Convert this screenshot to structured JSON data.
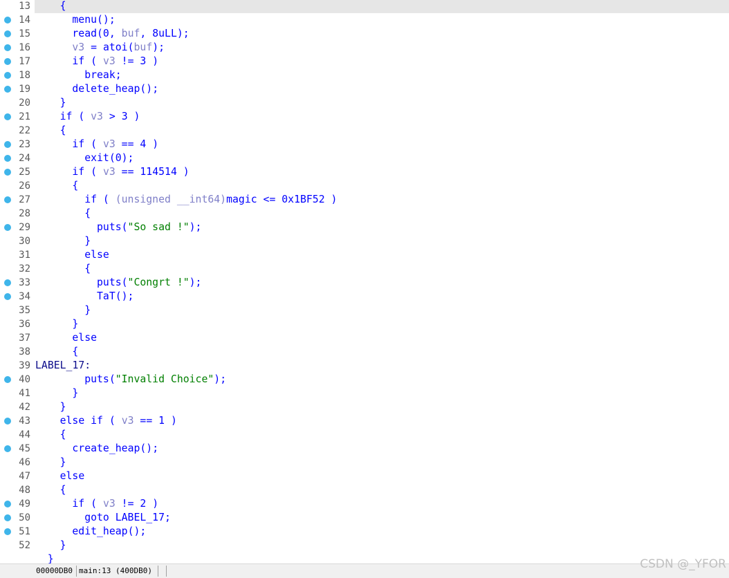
{
  "lines": [
    {
      "number": "13",
      "breakpoint": false,
      "indent": 2,
      "tokens": [
        {
          "t": "{",
          "k": "plain"
        }
      ]
    },
    {
      "number": "14",
      "breakpoint": true,
      "indent": 3,
      "tokens": [
        {
          "t": "menu();",
          "k": "plain"
        }
      ]
    },
    {
      "number": "15",
      "breakpoint": true,
      "indent": 3,
      "tokens": [
        {
          "t": "read(0, ",
          "k": "plain"
        },
        {
          "t": "buf",
          "k": "var"
        },
        {
          "t": ", 8uLL);",
          "k": "plain"
        }
      ]
    },
    {
      "number": "16",
      "breakpoint": true,
      "indent": 3,
      "tokens": [
        {
          "t": "v3",
          "k": "var"
        },
        {
          "t": " = atoi(",
          "k": "plain"
        },
        {
          "t": "buf",
          "k": "var"
        },
        {
          "t": ");",
          "k": "plain"
        }
      ]
    },
    {
      "number": "17",
      "breakpoint": true,
      "indent": 3,
      "tokens": [
        {
          "t": "if ( ",
          "k": "plain"
        },
        {
          "t": "v3",
          "k": "var"
        },
        {
          "t": " != 3 )",
          "k": "plain"
        }
      ]
    },
    {
      "number": "18",
      "breakpoint": true,
      "indent": 4,
      "tokens": [
        {
          "t": "break;",
          "k": "plain"
        }
      ]
    },
    {
      "number": "19",
      "breakpoint": true,
      "indent": 3,
      "tokens": [
        {
          "t": "delete_heap();",
          "k": "plain"
        }
      ]
    },
    {
      "number": "20",
      "breakpoint": false,
      "indent": 2,
      "tokens": [
        {
          "t": "}",
          "k": "plain"
        }
      ]
    },
    {
      "number": "21",
      "breakpoint": true,
      "indent": 2,
      "tokens": [
        {
          "t": "if ( ",
          "k": "plain"
        },
        {
          "t": "v3",
          "k": "var"
        },
        {
          "t": " > 3 )",
          "k": "plain"
        }
      ]
    },
    {
      "number": "22",
      "breakpoint": false,
      "indent": 2,
      "tokens": [
        {
          "t": "{",
          "k": "plain"
        }
      ]
    },
    {
      "number": "23",
      "breakpoint": true,
      "indent": 3,
      "tokens": [
        {
          "t": "if ( ",
          "k": "plain"
        },
        {
          "t": "v3",
          "k": "var"
        },
        {
          "t": " == 4 )",
          "k": "plain"
        }
      ]
    },
    {
      "number": "24",
      "breakpoint": true,
      "indent": 4,
      "tokens": [
        {
          "t": "exit(0);",
          "k": "plain"
        }
      ]
    },
    {
      "number": "25",
      "breakpoint": true,
      "indent": 3,
      "tokens": [
        {
          "t": "if ( ",
          "k": "plain"
        },
        {
          "t": "v3",
          "k": "var"
        },
        {
          "t": " == 114514 )",
          "k": "plain"
        }
      ]
    },
    {
      "number": "26",
      "breakpoint": false,
      "indent": 3,
      "tokens": [
        {
          "t": "{",
          "k": "plain"
        }
      ]
    },
    {
      "number": "27",
      "breakpoint": true,
      "indent": 4,
      "tokens": [
        {
          "t": "if ( ",
          "k": "plain"
        },
        {
          "t": "(unsigned __int64)",
          "k": "var"
        },
        {
          "t": "magic <= 0x1BF52 )",
          "k": "plain"
        }
      ]
    },
    {
      "number": "28",
      "breakpoint": false,
      "indent": 4,
      "tokens": [
        {
          "t": "{",
          "k": "plain"
        }
      ]
    },
    {
      "number": "29",
      "breakpoint": true,
      "indent": 5,
      "tokens": [
        {
          "t": "puts(",
          "k": "plain"
        },
        {
          "t": "\"So sad !\"",
          "k": "str"
        },
        {
          "t": ");",
          "k": "plain"
        }
      ]
    },
    {
      "number": "30",
      "breakpoint": false,
      "indent": 4,
      "tokens": [
        {
          "t": "}",
          "k": "plain"
        }
      ]
    },
    {
      "number": "31",
      "breakpoint": false,
      "indent": 4,
      "tokens": [
        {
          "t": "else",
          "k": "plain"
        }
      ]
    },
    {
      "number": "32",
      "breakpoint": false,
      "indent": 4,
      "tokens": [
        {
          "t": "{",
          "k": "plain"
        }
      ]
    },
    {
      "number": "33",
      "breakpoint": true,
      "indent": 5,
      "tokens": [
        {
          "t": "puts(",
          "k": "plain"
        },
        {
          "t": "\"Congrt !\"",
          "k": "str"
        },
        {
          "t": ");",
          "k": "plain"
        }
      ]
    },
    {
      "number": "34",
      "breakpoint": true,
      "indent": 5,
      "tokens": [
        {
          "t": "TaT();",
          "k": "plain"
        }
      ]
    },
    {
      "number": "35",
      "breakpoint": false,
      "indent": 4,
      "tokens": [
        {
          "t": "}",
          "k": "plain"
        }
      ]
    },
    {
      "number": "36",
      "breakpoint": false,
      "indent": 3,
      "tokens": [
        {
          "t": "}",
          "k": "plain"
        }
      ]
    },
    {
      "number": "37",
      "breakpoint": false,
      "indent": 3,
      "tokens": [
        {
          "t": "else",
          "k": "plain"
        }
      ]
    },
    {
      "number": "38",
      "breakpoint": false,
      "indent": 3,
      "tokens": [
        {
          "t": "{",
          "k": "plain"
        }
      ]
    },
    {
      "number": "39",
      "breakpoint": false,
      "indent": 0,
      "tokens": [
        {
          "t": "LABEL_17:",
          "k": "label"
        }
      ]
    },
    {
      "number": "40",
      "breakpoint": true,
      "indent": 4,
      "tokens": [
        {
          "t": "puts(",
          "k": "plain"
        },
        {
          "t": "\"Invalid Choice\"",
          "k": "str"
        },
        {
          "t": ");",
          "k": "plain"
        }
      ]
    },
    {
      "number": "41",
      "breakpoint": false,
      "indent": 3,
      "tokens": [
        {
          "t": "}",
          "k": "plain"
        }
      ]
    },
    {
      "number": "42",
      "breakpoint": false,
      "indent": 2,
      "tokens": [
        {
          "t": "}",
          "k": "plain"
        }
      ]
    },
    {
      "number": "43",
      "breakpoint": true,
      "indent": 2,
      "tokens": [
        {
          "t": "else if ( ",
          "k": "plain"
        },
        {
          "t": "v3",
          "k": "var"
        },
        {
          "t": " == 1 )",
          "k": "plain"
        }
      ]
    },
    {
      "number": "44",
      "breakpoint": false,
      "indent": 2,
      "tokens": [
        {
          "t": "{",
          "k": "plain"
        }
      ]
    },
    {
      "number": "45",
      "breakpoint": true,
      "indent": 3,
      "tokens": [
        {
          "t": "create_heap();",
          "k": "plain"
        }
      ]
    },
    {
      "number": "46",
      "breakpoint": false,
      "indent": 2,
      "tokens": [
        {
          "t": "}",
          "k": "plain"
        }
      ]
    },
    {
      "number": "47",
      "breakpoint": false,
      "indent": 2,
      "tokens": [
        {
          "t": "else",
          "k": "plain"
        }
      ]
    },
    {
      "number": "48",
      "breakpoint": false,
      "indent": 2,
      "tokens": [
        {
          "t": "{",
          "k": "plain"
        }
      ]
    },
    {
      "number": "49",
      "breakpoint": true,
      "indent": 3,
      "tokens": [
        {
          "t": "if ( ",
          "k": "plain"
        },
        {
          "t": "v3",
          "k": "var"
        },
        {
          "t": " != 2 )",
          "k": "plain"
        }
      ]
    },
    {
      "number": "50",
      "breakpoint": true,
      "indent": 4,
      "tokens": [
        {
          "t": "goto LABEL_17;",
          "k": "plain"
        }
      ]
    },
    {
      "number": "51",
      "breakpoint": true,
      "indent": 3,
      "tokens": [
        {
          "t": "edit_heap();",
          "k": "plain"
        }
      ]
    },
    {
      "number": "52",
      "breakpoint": false,
      "indent": 2,
      "tokens": [
        {
          "t": "}",
          "k": "plain"
        }
      ]
    },
    {
      "number": "",
      "breakpoint": false,
      "indent": 1,
      "tokens": [
        {
          "t": "}",
          "k": "plain"
        }
      ]
    }
  ],
  "current_line": "13",
  "status_bar": {
    "address": "00000DB0",
    "location": "main:13 (400DB0)"
  },
  "watermark": "CSDN @_YFOR",
  "colors": {
    "code": "#0000ff",
    "variable": "#7f7fc8",
    "string": "#007f00",
    "breakpoint": "#3fb5ea",
    "current_line_bg": "#e6e6e6"
  }
}
